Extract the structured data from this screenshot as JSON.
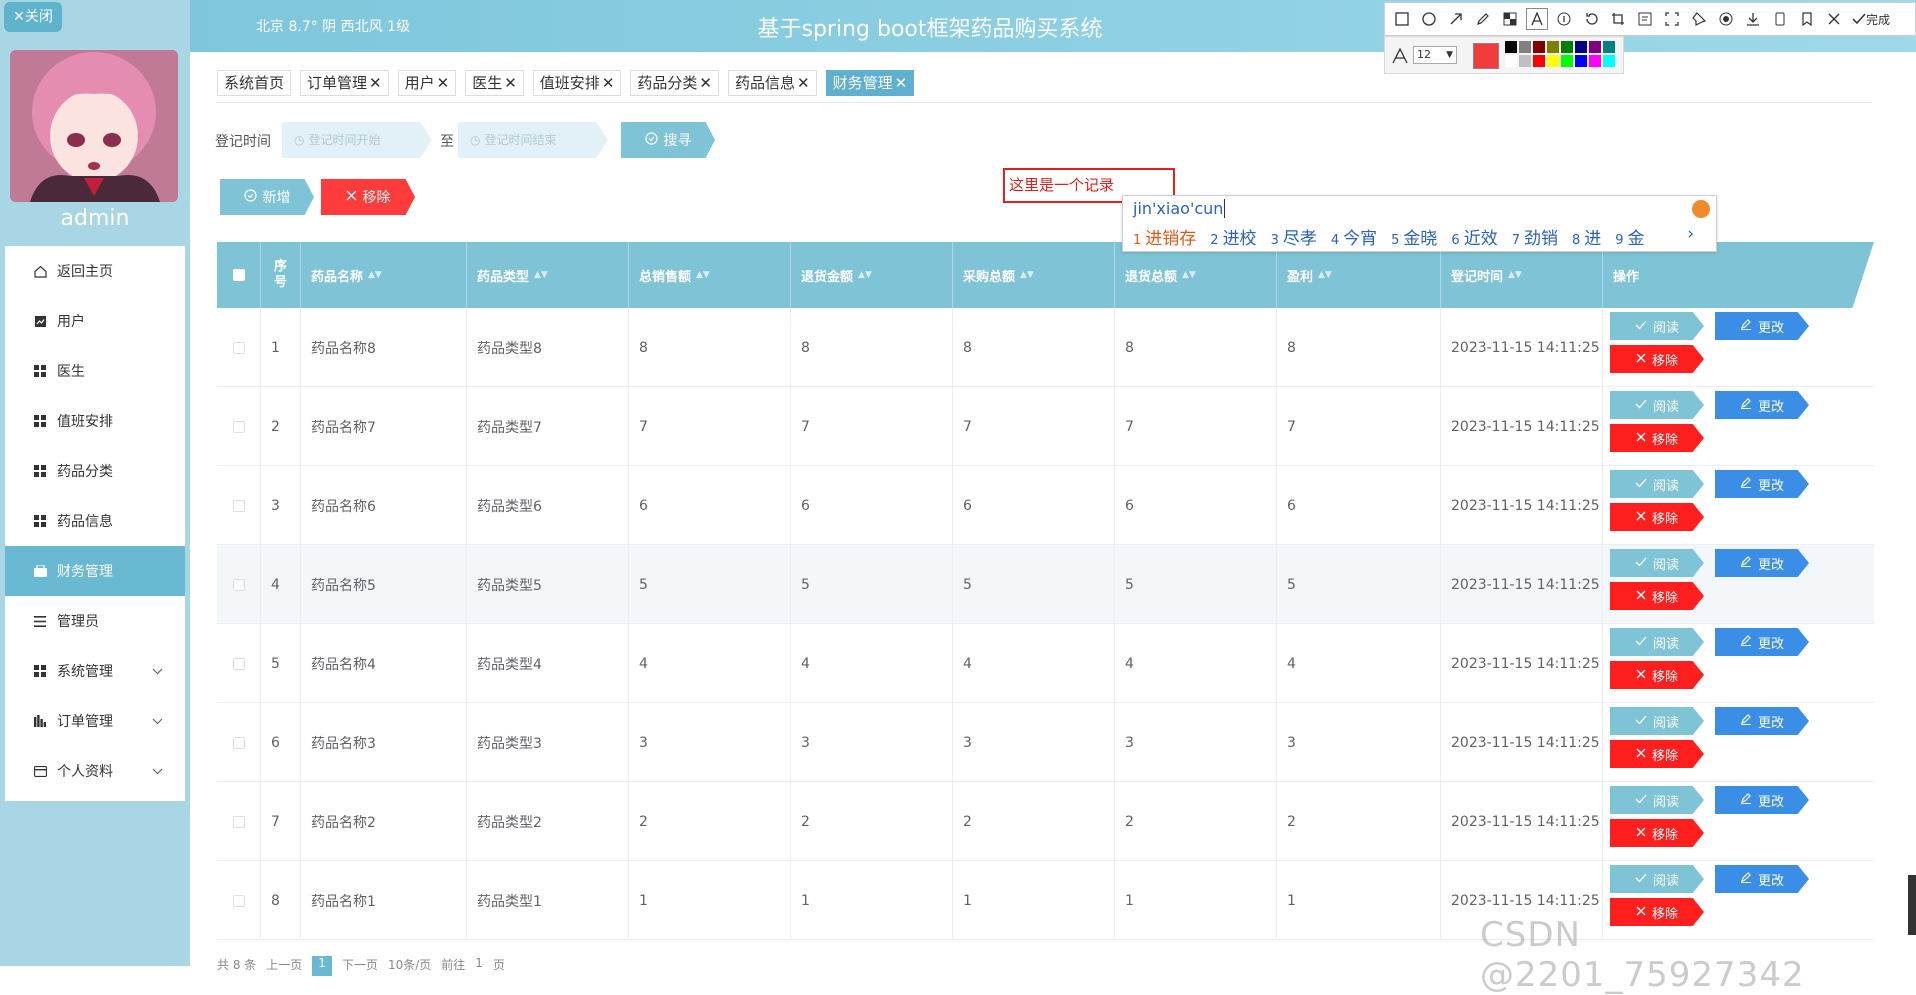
{
  "sidebar": {
    "close_label": "✕关闭",
    "username": "admin",
    "menu": [
      {
        "label": "返回主页",
        "icon": "home-icon"
      },
      {
        "label": "用户",
        "icon": "user-icon"
      },
      {
        "label": "医生",
        "icon": "grid-icon"
      },
      {
        "label": "值班安排",
        "icon": "grid-icon"
      },
      {
        "label": "药品分类",
        "icon": "grid-icon"
      },
      {
        "label": "药品信息",
        "icon": "grid-icon"
      },
      {
        "label": "财务管理",
        "icon": "finance-icon",
        "active": true
      },
      {
        "label": "管理员",
        "icon": "list-icon"
      },
      {
        "label": "系统管理",
        "icon": "grid-icon",
        "expandable": true
      },
      {
        "label": "订单管理",
        "icon": "chart-icon",
        "expandable": true
      },
      {
        "label": "个人资料",
        "icon": "card-icon",
        "expandable": true
      }
    ]
  },
  "header": {
    "weather": "北京  8.7°  阴  西北风  1级",
    "title": "基于spring boot框架药品购买系统"
  },
  "screenshot_tool": {
    "font_size": "12",
    "done_label": "完成",
    "current_color": "#f23c3c",
    "palette": [
      "#000000",
      "#808080",
      "#800000",
      "#808000",
      "#008000",
      "#000080",
      "#800080",
      "#008080",
      "#ffffff",
      "#c0c0c0",
      "#ff0000",
      "#ffff00",
      "#00ff00",
      "#0000ff",
      "#ff00ff",
      "#00ffff"
    ]
  },
  "tabs": [
    {
      "label": "系统首页",
      "closable": false
    },
    {
      "label": "订单管理",
      "closable": true
    },
    {
      "label": "用户",
      "closable": true
    },
    {
      "label": "医生",
      "closable": true
    },
    {
      "label": "值班安排",
      "closable": true
    },
    {
      "label": "药品分类",
      "closable": true
    },
    {
      "label": "药品信息",
      "closable": true
    },
    {
      "label": "财务管理",
      "closable": true,
      "active": true
    }
  ],
  "search": {
    "label": "登记时间",
    "start_placeholder": "登记时间开始",
    "to_label": "至",
    "end_placeholder": "登记时间结束",
    "search_button": "搜寻"
  },
  "actions": {
    "add_button": "新增",
    "delete_button": "移除"
  },
  "annotation": {
    "text": "这里是一个记录"
  },
  "ime": {
    "pinyin": "jin'xiao'cun",
    "candidates": [
      {
        "n": "1",
        "text": "进销存"
      },
      {
        "n": "2",
        "text": "进校"
      },
      {
        "n": "3",
        "text": "尽孝"
      },
      {
        "n": "4",
        "text": "今宵"
      },
      {
        "n": "5",
        "text": "金晓"
      },
      {
        "n": "6",
        "text": "近效"
      },
      {
        "n": "7",
        "text": "劲销"
      },
      {
        "n": "8",
        "text": "进"
      },
      {
        "n": "9",
        "text": "金"
      }
    ],
    "next": "›"
  },
  "table": {
    "headers": [
      "序号",
      "药品名称",
      "药品类型",
      "总销售额",
      "退货金额",
      "采购总额",
      "退货总额",
      "盈利",
      "登记时间",
      "操作"
    ],
    "rows": [
      [
        "1",
        "药品名称8",
        "药品类型8",
        "8",
        "8",
        "8",
        "8",
        "8",
        "2023-11-15 14:11:25"
      ],
      [
        "2",
        "药品名称7",
        "药品类型7",
        "7",
        "7",
        "7",
        "7",
        "7",
        "2023-11-15 14:11:25"
      ],
      [
        "3",
        "药品名称6",
        "药品类型6",
        "6",
        "6",
        "6",
        "6",
        "6",
        "2023-11-15 14:11:25"
      ],
      [
        "4",
        "药品名称5",
        "药品类型5",
        "5",
        "5",
        "5",
        "5",
        "5",
        "2023-11-15 14:11:25"
      ],
      [
        "5",
        "药品名称4",
        "药品类型4",
        "4",
        "4",
        "4",
        "4",
        "4",
        "2023-11-15 14:11:25"
      ],
      [
        "6",
        "药品名称3",
        "药品类型3",
        "3",
        "3",
        "3",
        "3",
        "3",
        "2023-11-15 14:11:25"
      ],
      [
        "7",
        "药品名称2",
        "药品类型2",
        "2",
        "2",
        "2",
        "2",
        "2",
        "2023-11-15 14:11:25"
      ],
      [
        "8",
        "药品名称1",
        "药品类型1",
        "1",
        "1",
        "1",
        "1",
        "1",
        "2023-11-15 14:11:25"
      ]
    ],
    "row_actions": {
      "view": "阅读",
      "edit": "更改",
      "delete": "移除"
    }
  },
  "pagination": {
    "total": "共 8 条",
    "prev": "上一页",
    "page": "1",
    "next": "下一页",
    "page_size": "10条/页",
    "goto": "前往",
    "goto_page": "1",
    "page_unit": "页"
  },
  "watermark": "CSDN @2201_75927342",
  "colors": {
    "primary": "#7ec3d6",
    "active_tab": "#5fb0cf",
    "edit": "#3a8ee6",
    "danger": "#ff1f1f"
  }
}
